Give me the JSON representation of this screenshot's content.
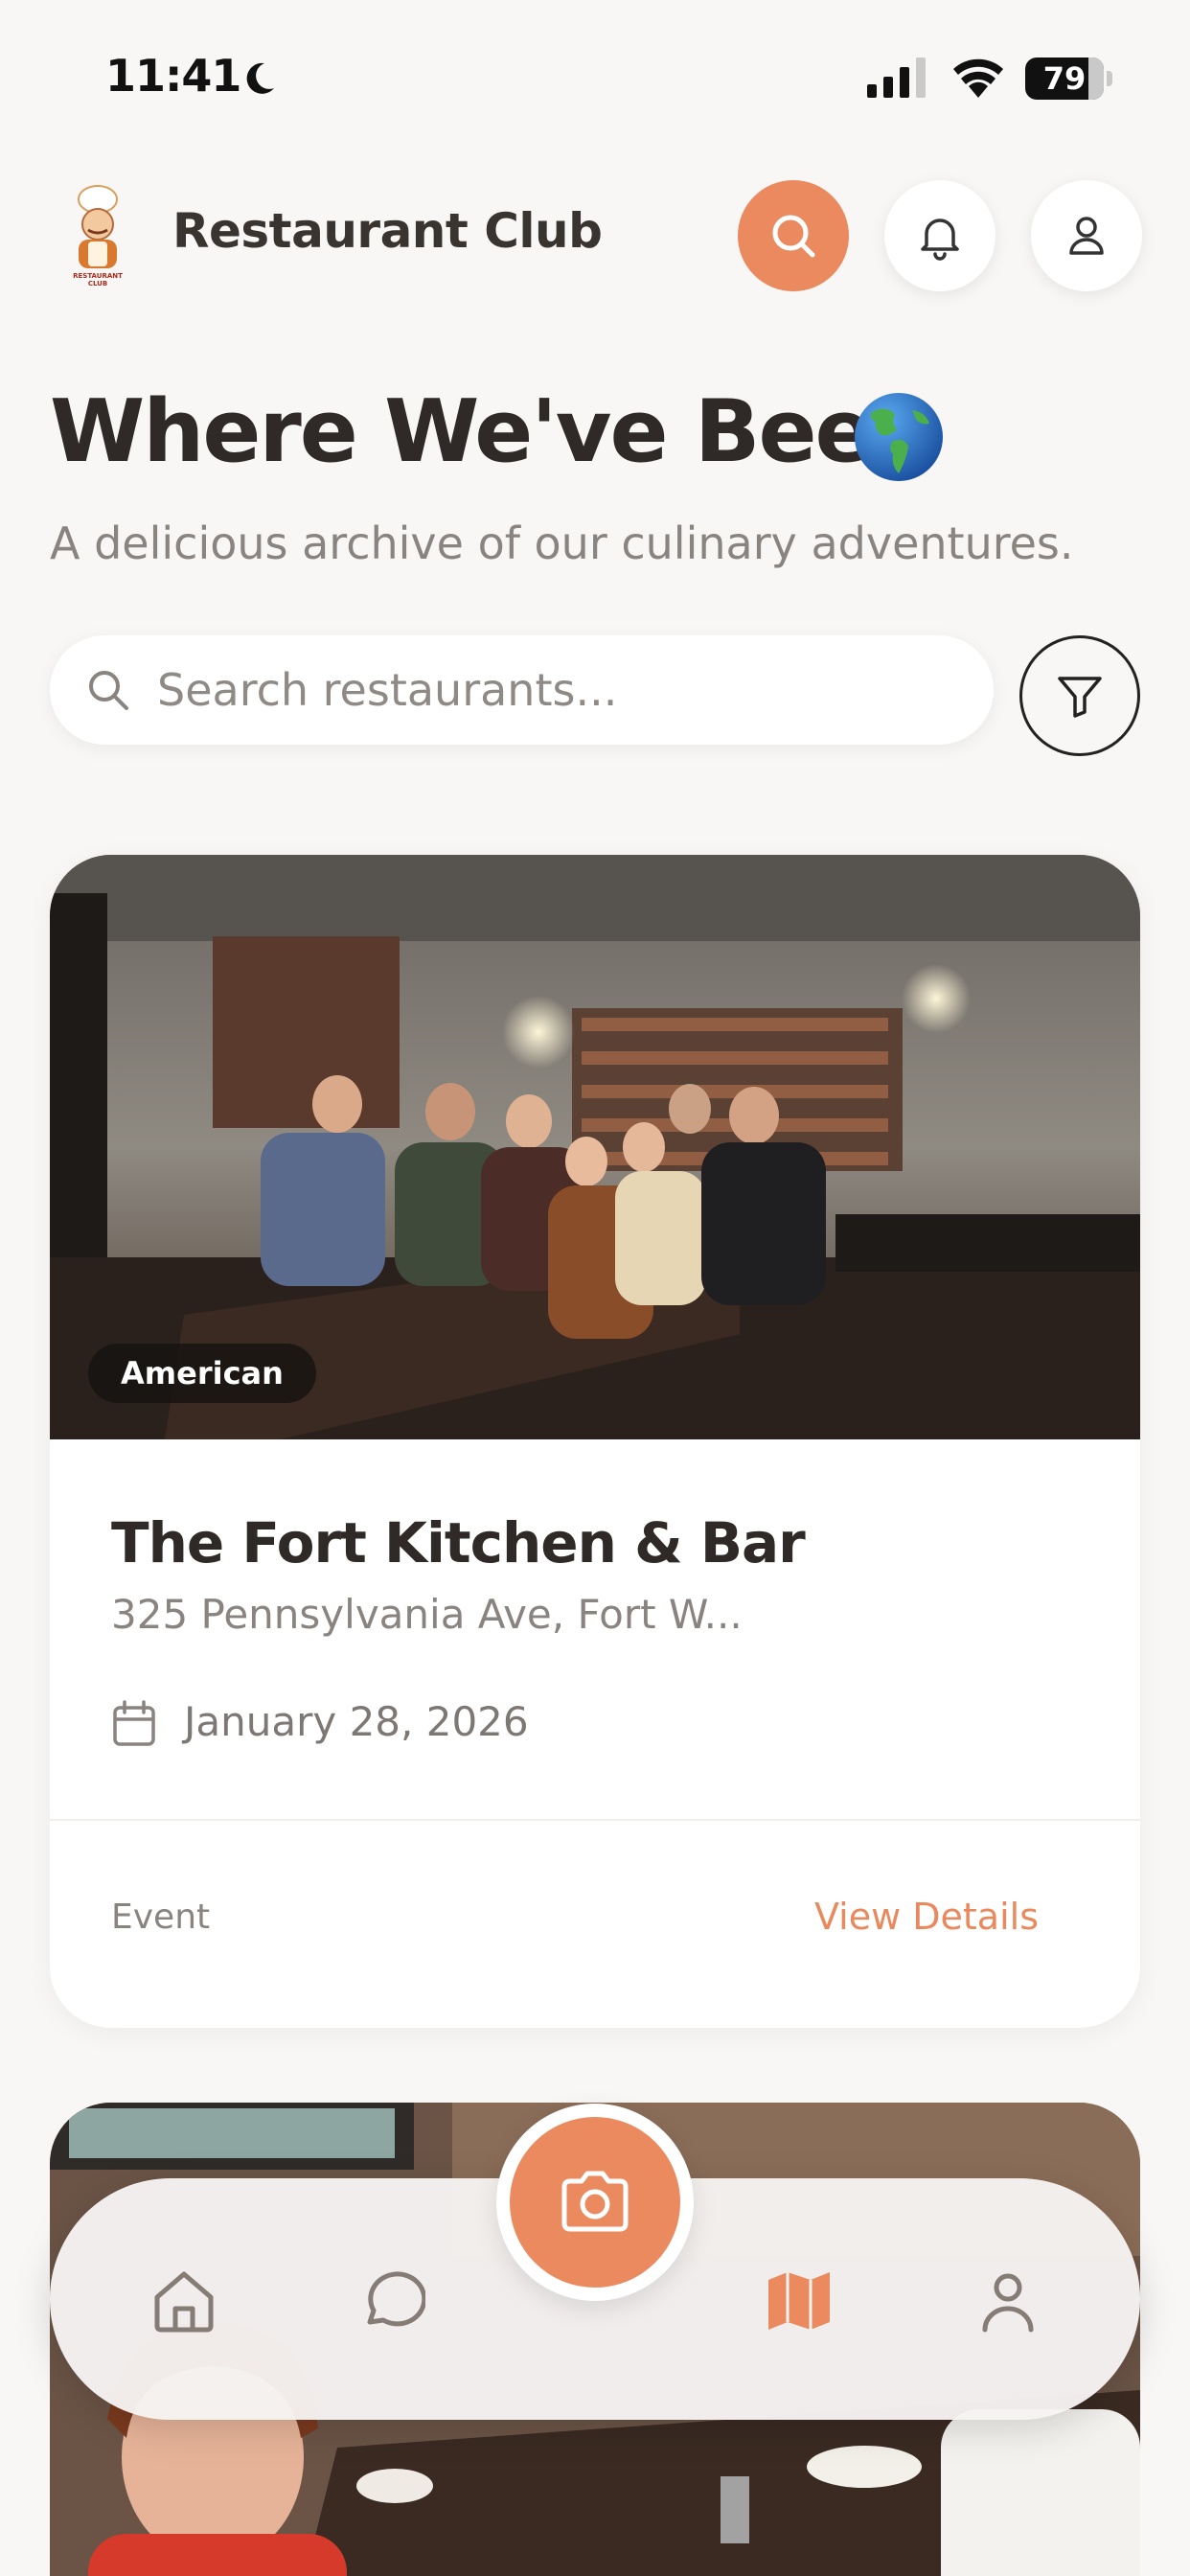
{
  "status_bar": {
    "time": "11:41",
    "battery": "79"
  },
  "header": {
    "app_name": "Restaurant Club",
    "logo_text": "RESTAURANT CLUB"
  },
  "page": {
    "title": "Where We've Been",
    "subtitle": "A delicious archive of our culinary adventures."
  },
  "search": {
    "placeholder": "Search restaurants...",
    "value": ""
  },
  "restaurants": [
    {
      "cuisine": "American",
      "name": "The Fort Kitchen & Bar",
      "address": "325 Pennsylvania Ave, Fort W...",
      "date": "January 28, 2026",
      "type": "Event",
      "link_label": "View Details"
    }
  ],
  "colors": {
    "accent": "#ea8a5e",
    "background": "#f9f7f5",
    "text": "#2f2a27",
    "muted": "#8a8480"
  },
  "icons": {
    "header": [
      "search-icon",
      "bell-icon",
      "user-icon"
    ],
    "nav": [
      "home-icon",
      "chat-icon",
      "camera-icon",
      "map-icon",
      "profile-icon"
    ],
    "nav_active": "map-icon"
  }
}
